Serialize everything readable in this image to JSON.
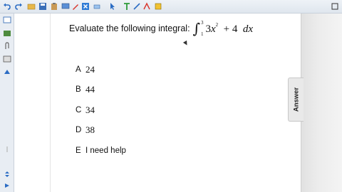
{
  "question": {
    "prompt": "Evaluate the following integral:",
    "integral": {
      "upper": "3",
      "lower": "1",
      "term1_coef": "3",
      "term1_var": "x",
      "term1_exp": "2",
      "op": "+",
      "constant": "4",
      "differential": "dx"
    }
  },
  "options": [
    {
      "letter": "A",
      "text": "24"
    },
    {
      "letter": "B",
      "text": "44"
    },
    {
      "letter": "C",
      "text": "34"
    },
    {
      "letter": "D",
      "text": "38"
    },
    {
      "letter": "E",
      "text": "I need help"
    }
  ],
  "answer_tab": {
    "label": "Answer"
  },
  "colors": {
    "toolbar": "#e6ebf1",
    "icon_blue": "#2b6cc4",
    "icon_red": "#d9342b",
    "icon_green": "#2e9b3a"
  },
  "icons": [
    "undo-icon",
    "redo-icon",
    "folder-icon",
    "save-icon",
    "paste-icon",
    "screen-icon",
    "pen-icon",
    "close-icon",
    "eraser-icon",
    "pointer-icon",
    "text-icon",
    "line-icon",
    "shape-icon",
    "page-sorter-icon",
    "gallery-icon",
    "attachments-icon",
    "properties-icon",
    "addons-icon"
  ]
}
